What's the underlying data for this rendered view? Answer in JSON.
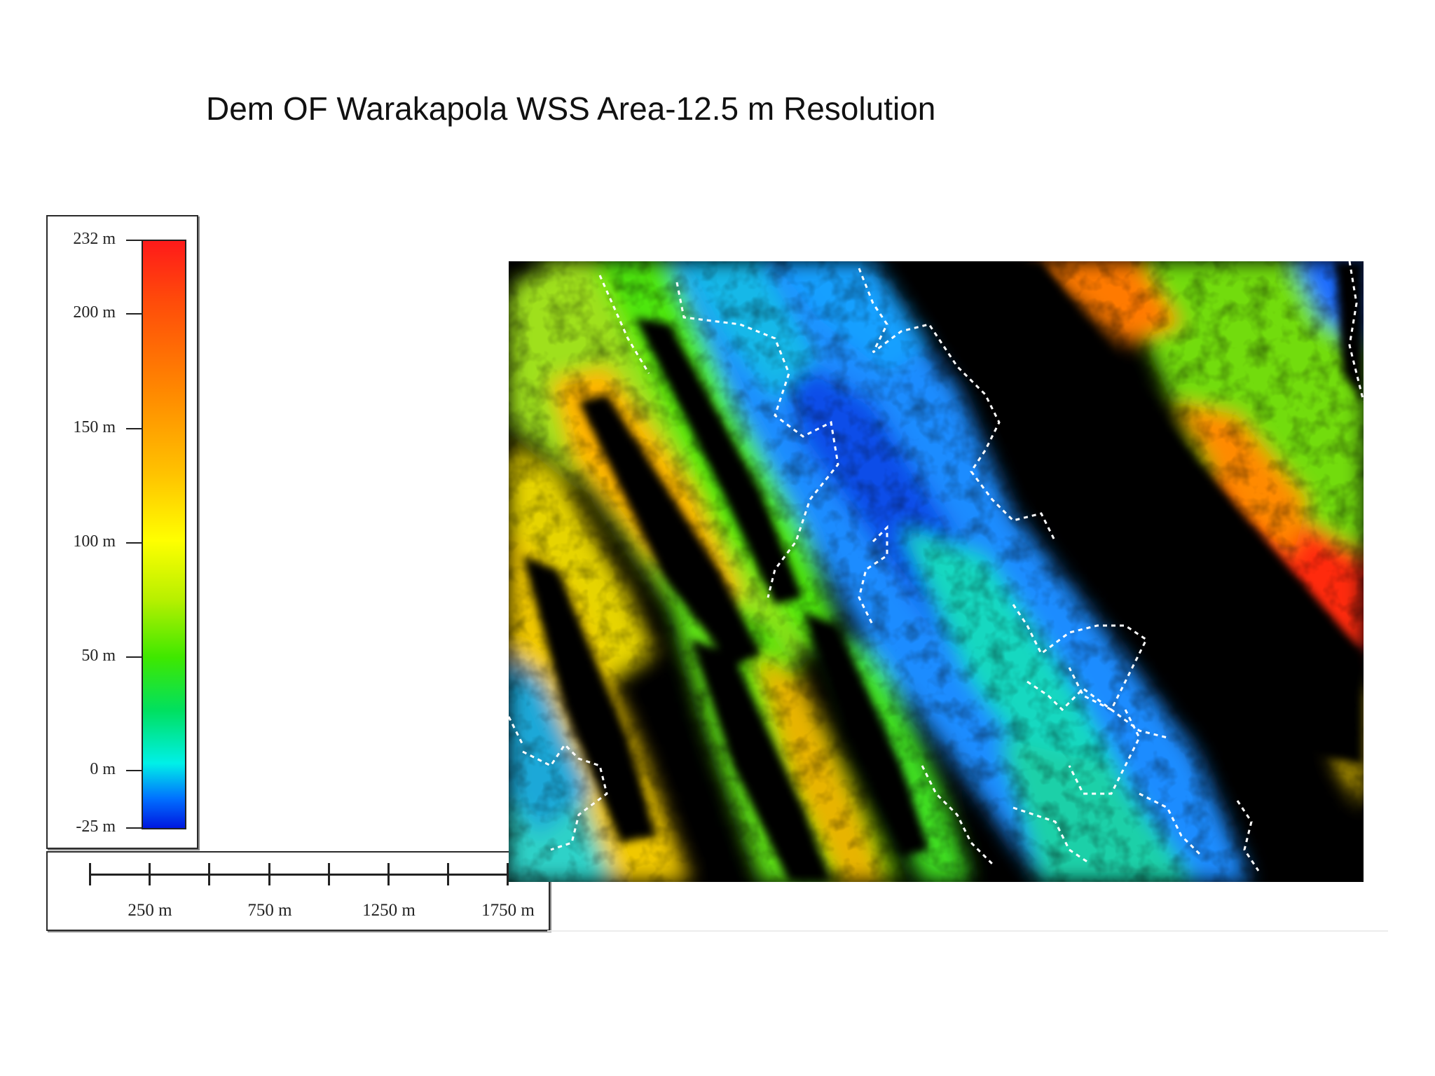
{
  "title": "Dem OF Warakapola WSS Area-12.5 m Resolution",
  "legend": {
    "ticks": [
      {
        "label": "232 m",
        "value": 232
      },
      {
        "label": "200 m",
        "value": 200
      },
      {
        "label": "150 m",
        "value": 150
      },
      {
        "label": "100 m",
        "value": 100
      },
      {
        "label": "50 m",
        "value": 50
      },
      {
        "label": "0 m",
        "value": 0
      },
      {
        "label": "-25 m",
        "value": -25
      }
    ],
    "min_value": -25,
    "max_value": 232,
    "colors": {
      "high": "#ff1a1a",
      "mid_high": "#ff8a00",
      "mid": "#ffff00",
      "mid_low": "#3ee800",
      "low": "#00f0e8",
      "lowest": "#0018e0"
    }
  },
  "scalebar": {
    "labels": [
      "250 m",
      "750 m",
      "1250 m",
      "1750 m"
    ],
    "tick_count": 8
  },
  "map": {
    "description_icon": "elevation-raster-map",
    "shading_color": "#000000",
    "boundary_color": "#ffffff"
  }
}
